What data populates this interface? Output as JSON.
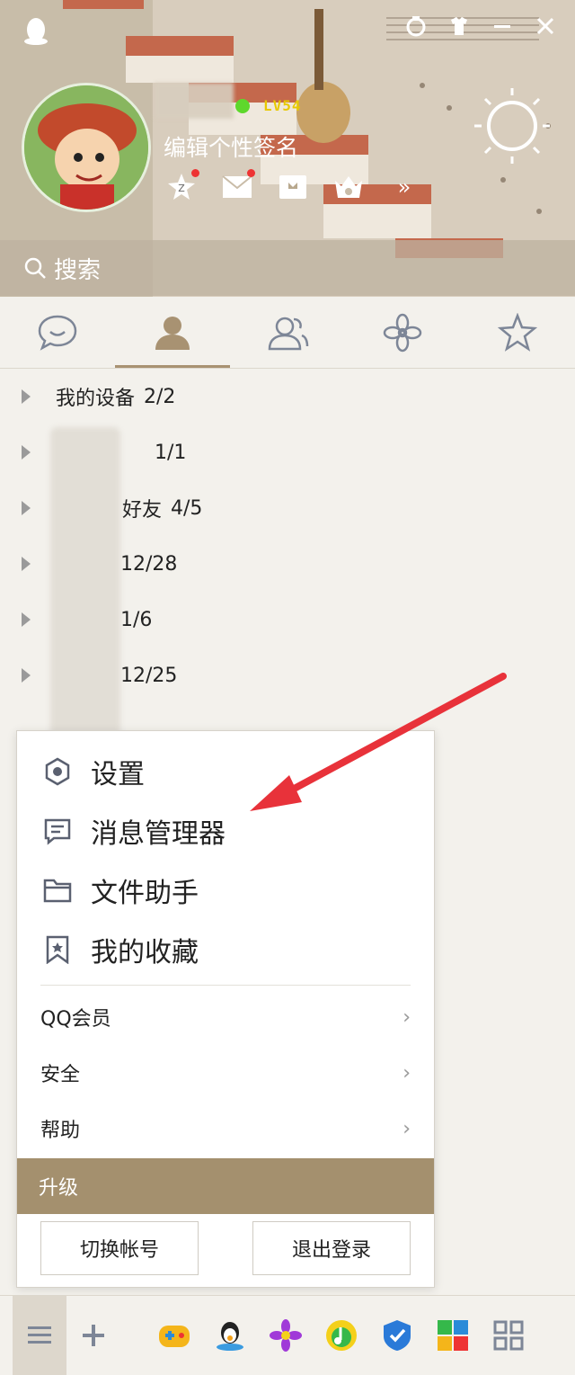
{
  "header": {
    "level": "LV54",
    "signature": "编辑个性签名",
    "search_placeholder": "搜索"
  },
  "tabs": [
    "messages-tab",
    "contacts-tab",
    "groups-tab",
    "apps-tab",
    "favorites-tab"
  ],
  "groups": [
    {
      "name": "我的设备",
      "count": "2/2"
    },
    {
      "name": "",
      "count": "1/1"
    },
    {
      "name": "好友",
      "count": "4/5"
    },
    {
      "name": "",
      "count": "12/28"
    },
    {
      "name": "",
      "count": "1/6"
    },
    {
      "name": "",
      "count": "12/25"
    }
  ],
  "menu": {
    "primary": [
      {
        "label": "设置",
        "icon": "settings-icon"
      },
      {
        "label": "消息管理器",
        "icon": "message-manager-icon"
      },
      {
        "label": "文件助手",
        "icon": "folder-icon"
      },
      {
        "label": "我的收藏",
        "icon": "bookmark-icon"
      }
    ],
    "secondary": [
      {
        "label": "QQ会员",
        "chevron": "›"
      },
      {
        "label": "安全",
        "chevron": "›"
      },
      {
        "label": "帮助",
        "chevron": "›"
      }
    ],
    "upgrade": "升级",
    "switch_account": "切换帐号",
    "logout": "退出登录"
  },
  "colors": {
    "accent": "#a4906e",
    "online": "#5ed82c",
    "arrow": "#e8323a"
  }
}
